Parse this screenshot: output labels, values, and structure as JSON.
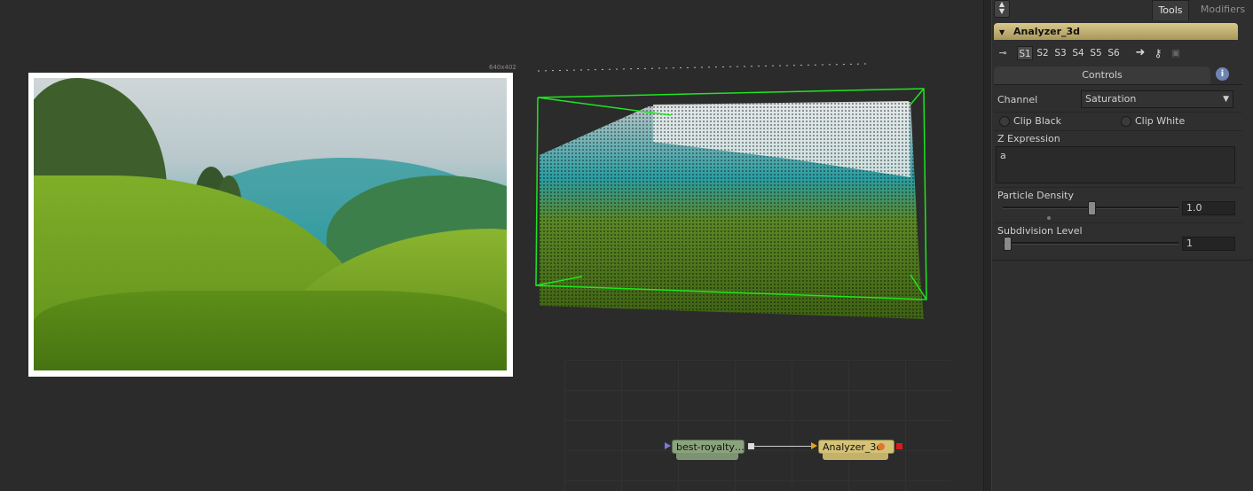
{
  "viewer_left": {
    "resolution": "640x402"
  },
  "flow": {
    "nodes": [
      {
        "label": "best-royalty…"
      },
      {
        "label": "Analyzer_3d"
      }
    ]
  },
  "panel": {
    "tabs": [
      {
        "label": "Tools",
        "active": true
      },
      {
        "label": "Modifiers",
        "active": false
      }
    ],
    "tool_name": "Analyzer_3d",
    "subtools": [
      "S1",
      "S2",
      "S3",
      "S4",
      "S5",
      "S6"
    ],
    "controls_tab": "Controls",
    "channel": {
      "label": "Channel",
      "value": "Saturation"
    },
    "clip_black": {
      "label": "Clip Black",
      "checked": false
    },
    "clip_white": {
      "label": "Clip White",
      "checked": false
    },
    "z_expression": {
      "label": "Z Expression",
      "value": "a"
    },
    "particle_density": {
      "label": "Particle Density",
      "value": "1.0"
    },
    "subdivision_level": {
      "label": "Subdivision Level",
      "value": "1"
    }
  },
  "colors": {
    "panel_bg": "#2f2f2f",
    "tool_header": "#c9b77a",
    "bounding_box": "#1ee61e",
    "loader_node": "#8aa37d",
    "analyzer_node": "#d4c277"
  }
}
